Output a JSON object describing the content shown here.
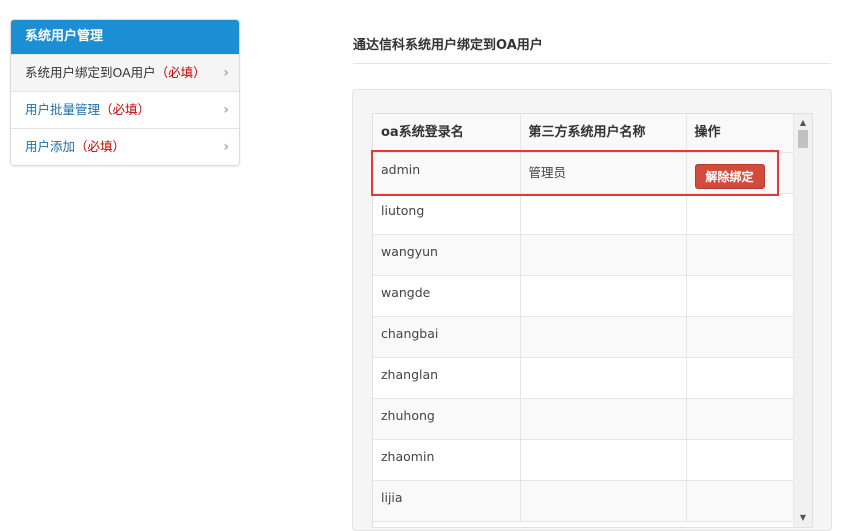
{
  "sidebar": {
    "title": "系统用户管理",
    "items": [
      {
        "label": "系统用户绑定到OA用户",
        "required": "（必填）"
      },
      {
        "label": "用户批量管理",
        "required": "（必填）"
      },
      {
        "label": "用户添加",
        "required": "（必填）"
      }
    ]
  },
  "main": {
    "title": "通达信科系统用户绑定到OA用户",
    "table": {
      "headers": [
        "oa系统登录名",
        "第三方系统用户名称",
        "操作"
      ],
      "rows": [
        {
          "login": "admin",
          "third_party": "管理员",
          "action": "解除绑定"
        },
        {
          "login": "liutong",
          "third_party": "",
          "action": ""
        },
        {
          "login": "wangyun",
          "third_party": "",
          "action": ""
        },
        {
          "login": "wangde",
          "third_party": "",
          "action": ""
        },
        {
          "login": "changbai",
          "third_party": "",
          "action": ""
        },
        {
          "login": "zhanglan",
          "third_party": "",
          "action": ""
        },
        {
          "login": "zhuhong",
          "third_party": "",
          "action": ""
        },
        {
          "login": "zhaomin",
          "third_party": "",
          "action": ""
        },
        {
          "login": "lijia",
          "third_party": "",
          "action": ""
        }
      ]
    }
  },
  "colors": {
    "sidebar_header": "#1a8fd3",
    "unbind_button": "#d24b3c",
    "highlight": "#e53935",
    "required": "#cc0000"
  },
  "icons": {
    "chevron": "chevron-right-icon",
    "scroll_up": "scroll-up-arrow-icon",
    "scroll_down": "scroll-down-arrow-icon"
  }
}
